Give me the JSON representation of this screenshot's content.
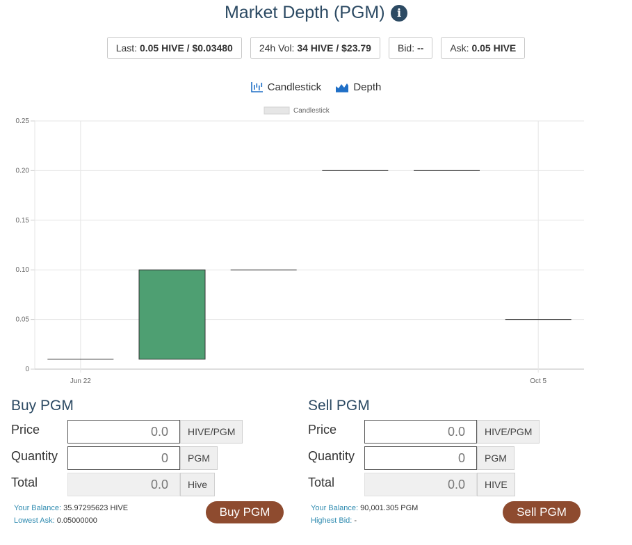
{
  "header": {
    "title": "Market Depth (PGM)",
    "info_icon": "info-circle-icon"
  },
  "stats": [
    {
      "label": "Last:",
      "value": "0.05 HIVE / $0.03480"
    },
    {
      "label": "24h Vol:",
      "value": "34 HIVE / $23.79"
    },
    {
      "label": "Bid:",
      "value": "--"
    },
    {
      "label": "Ask:",
      "value": "0.05 HIVE"
    }
  ],
  "chart_tabs": [
    {
      "label": "Candlestick",
      "icon": "candlestick-chart-icon"
    },
    {
      "label": "Depth",
      "icon": "area-chart-icon"
    }
  ],
  "colors": {
    "accent": "#2c4a63",
    "up_candle": "#4e9f72",
    "button": "#8e4b2f",
    "link_label": "#2f8bb0",
    "icon_blue": "#1f6fc6"
  },
  "chart_data": {
    "type": "candlestick",
    "legend": "Candlestick",
    "legend_position": "top-center",
    "grid": true,
    "ylim": [
      0,
      0.25
    ],
    "y_ticks": [
      0,
      0.05,
      0.1,
      0.15,
      0.2,
      0.25
    ],
    "y_tick_labels": [
      "0",
      "0.05",
      "0.10",
      "0.15",
      "0.20",
      "0.25"
    ],
    "x_tick_labels": [
      {
        "label": "Jun 22",
        "candle_index": 0
      },
      {
        "label": "Oct 5",
        "candle_index": 5
      }
    ],
    "candles": [
      {
        "open": 0.01,
        "close": 0.01
      },
      {
        "open": 0.01,
        "close": 0.1
      },
      {
        "open": 0.1,
        "close": 0.1
      },
      {
        "open": 0.2,
        "close": 0.2
      },
      {
        "open": 0.2,
        "close": 0.2
      },
      {
        "open": 0.05,
        "close": 0.05
      }
    ]
  },
  "buy": {
    "title": "Buy PGM",
    "price_label": "Price",
    "price_value": "0.0",
    "price_unit": "HIVE/PGM",
    "quantity_label": "Quantity",
    "quantity_value": "0",
    "quantity_unit": "PGM",
    "total_label": "Total",
    "total_value": "0.0",
    "total_unit": "Hive",
    "balance_label": "Your Balance:",
    "balance_value": "35.97295623 HIVE",
    "extra_label": "Lowest Ask:",
    "extra_value": "0.05000000",
    "button": "Buy PGM"
  },
  "sell": {
    "title": "Sell PGM",
    "price_label": "Price",
    "price_value": "0.0",
    "price_unit": "HIVE/PGM",
    "quantity_label": "Quantity",
    "quantity_value": "0",
    "quantity_unit": "PGM",
    "total_label": "Total",
    "total_value": "0.0",
    "total_unit": "HIVE",
    "balance_label": "Your Balance:",
    "balance_value": "90,001.305 PGM",
    "extra_label": "Highest Bid:",
    "extra_value": "-",
    "button": "Sell PGM"
  }
}
